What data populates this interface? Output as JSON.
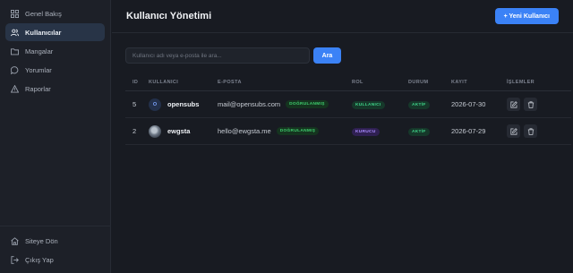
{
  "sidebar": {
    "items": [
      {
        "label": "Genel Bakış",
        "icon": "grid-icon",
        "active": false
      },
      {
        "label": "Kullanıcılar",
        "icon": "users-icon",
        "active": true
      },
      {
        "label": "Mangalar",
        "icon": "folder-icon",
        "active": false
      },
      {
        "label": "Yorumlar",
        "icon": "chat-icon",
        "active": false
      },
      {
        "label": "Raporlar",
        "icon": "warning-icon",
        "active": false
      }
    ],
    "bottom": [
      {
        "label": "Siteye Dön",
        "icon": "home-icon"
      },
      {
        "label": "Çıkış Yap",
        "icon": "logout-icon"
      }
    ]
  },
  "header": {
    "title": "Kullanıcı Yönetimi",
    "new_user_label": "+ Yeni Kullanıcı"
  },
  "search": {
    "placeholder": "Kullanıcı adı veya e-posta ile ara...",
    "value": "",
    "button_label": "Ara"
  },
  "table": {
    "columns": [
      "ID",
      "KULLANICI",
      "E-POSTA",
      "ROL",
      "DURUM",
      "KAYIT",
      "İŞLEMLER"
    ],
    "rows": [
      {
        "id": "5",
        "avatar_letter": "O",
        "username": "opensubs",
        "email": "mail@opensubs.com",
        "verified": "DOĞRULANMIŞ",
        "role": "KULLANICI",
        "status": "AKTİF",
        "date": "2026-07-30"
      },
      {
        "id": "2",
        "avatar_letter": "",
        "username": "ewgsta",
        "email": "hello@ewgsta.me",
        "verified": "DOĞRULANMIŞ",
        "role": "KURUCU",
        "status": "AKTİF",
        "date": "2026-07-29"
      }
    ]
  },
  "colors": {
    "accent": "#3b82f6",
    "background": "#181b22",
    "sidebar": "#1d2028",
    "success": "#40d58a",
    "owner": "#a98bff"
  }
}
